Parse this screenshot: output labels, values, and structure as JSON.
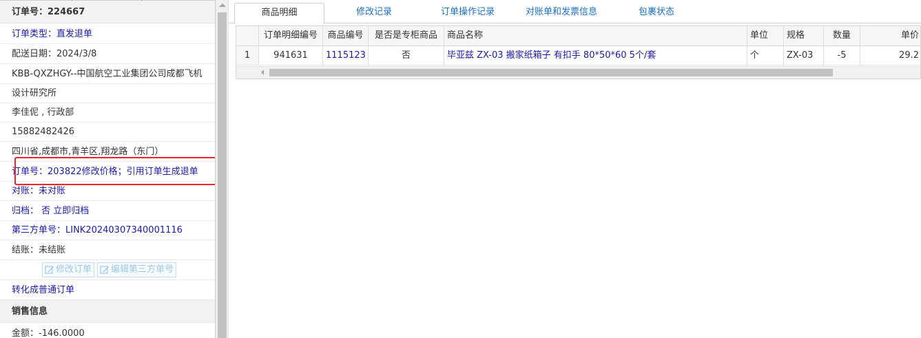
{
  "order": {
    "header": "订单号：224667",
    "type": "订单类型：直发退单",
    "delivery_date": "配送日期：2024/3/8",
    "customer_line1": "KBB-QXZHGY--中国航空工业集团公司成都飞机",
    "customer_line2": "设计研究所",
    "contact": "李佳伲 , 行政部",
    "phone": "15882482426",
    "address": "四川省,成都市,青羊区,翔龙路（东门）",
    "note": "订单号：203822修改价格；引用订单生成退单",
    "reconcile": "对账：未对账",
    "archive": "归档：  否 立即归档",
    "third_party": "第三方单号：LINK20240307340001116",
    "settle": "结账：未结账",
    "edit_order_label": "修改订单",
    "edit_third_label": "编辑第三方单号",
    "convert_label": "转化成普通订单"
  },
  "sales": {
    "header": "销售信息",
    "amount": "金额：-146.0000"
  },
  "tabs": [
    {
      "label": "商品明细",
      "active": true
    },
    {
      "label": "修改记录",
      "active": false
    },
    {
      "label": "订单操作记录",
      "active": false
    },
    {
      "label": "对账单和发票信息",
      "active": false
    },
    {
      "label": "包裹状态",
      "active": false
    }
  ],
  "grid": {
    "columns": [
      "",
      "订单明细编号",
      "商品编号",
      "是否是专柜商品",
      "商品名称",
      "单位",
      "规格",
      "数量",
      "单价"
    ],
    "rows": [
      {
        "index": "1",
        "detail_id": "941631",
        "product_id": "1115123",
        "counter": "否",
        "name": "毕亚兹 ZX-03 搬家纸箱子 有扣手 80*50*60 5个/套",
        "unit": "个",
        "spec": "ZX-03",
        "qty": "-5",
        "price": "29.2"
      }
    ]
  },
  "colors": {
    "link": "#1a1aa6",
    "highlight": "#e8262b",
    "tab_text": "#1a6fc2"
  }
}
